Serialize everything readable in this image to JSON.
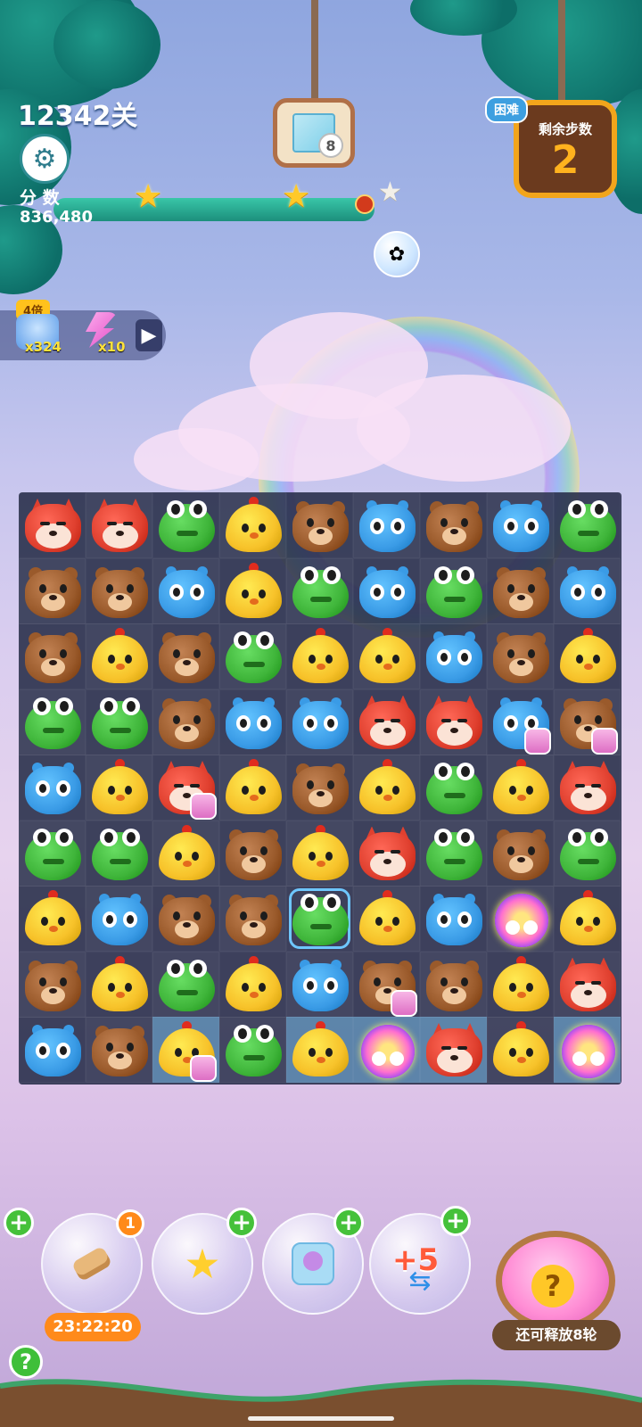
{
  "hud": {
    "level_label": "12342关",
    "score_label": "分 数",
    "score_value": "836,480",
    "settings_icon": "gear-icon"
  },
  "goal": {
    "count": "8",
    "item": "ice-tile"
  },
  "moves": {
    "difficulty": "困难",
    "label": "剩余步数",
    "value": "2"
  },
  "progress": {
    "stars_earned": 2,
    "stars_total": 3
  },
  "boosters_strip": {
    "multiplier": "4倍",
    "items": [
      {
        "icon": "blue-cloud-booster-icon",
        "count": "x324"
      },
      {
        "icon": "lightning-booster-icon",
        "count": "x10"
      }
    ],
    "expand_icon": "play-triangle-icon"
  },
  "board": {
    "cols": 9,
    "rows": 9,
    "pieces": [
      [
        "fox",
        "fox",
        "frog",
        "chick",
        "bear",
        "hippo",
        "bear",
        "hippo",
        "frog"
      ],
      [
        "bear",
        "bear",
        "hippo",
        "chick",
        "frog",
        "hippo",
        "frog",
        "bear",
        "hippo"
      ],
      [
        "bear",
        "chick",
        "bear",
        "frog",
        "chick",
        "chick",
        "hippo",
        "bear",
        "chick"
      ],
      [
        "frog",
        "frog",
        "bear",
        "hippo",
        "hippo",
        "fox",
        "fox",
        "hippo",
        "bear"
      ],
      [
        "hippo",
        "chick",
        "fox",
        "chick",
        "bear",
        "chick",
        "frog",
        "chick",
        "fox"
      ],
      [
        "frog",
        "frog",
        "chick",
        "bear",
        "chick",
        "fox",
        "frog",
        "bear",
        "frog"
      ],
      [
        "chick",
        "hippo",
        "bear",
        "bear",
        "frog",
        "chick",
        "hippo",
        "owl",
        "chick"
      ],
      [
        "bear",
        "chick",
        "frog",
        "chick",
        "hippo",
        "bear",
        "bear",
        "chick",
        "fox"
      ],
      [
        "hippo",
        "bear",
        "chick",
        "frog",
        "chick",
        "owl",
        "fox",
        "chick",
        "owl"
      ]
    ],
    "jars": [
      [
        3,
        7
      ],
      [
        3,
        8
      ],
      [
        4,
        2
      ],
      [
        7,
        5
      ],
      [
        8,
        2
      ]
    ],
    "ice_cells": [
      [
        8,
        2
      ],
      [
        8,
        4
      ],
      [
        8,
        5
      ],
      [
        8,
        6
      ],
      [
        8,
        8
      ]
    ],
    "selected": [
      6,
      4
    ]
  },
  "tools": [
    {
      "name": "hammer",
      "icon": "hammer-icon",
      "badge": "1",
      "timer": "23:22:20"
    },
    {
      "name": "magic-wand",
      "icon": "star-wand-icon"
    },
    {
      "name": "octopus",
      "icon": "octopus-icon"
    },
    {
      "name": "extra-moves",
      "icon": "swap-arrows-icon",
      "label": "+5"
    }
  ],
  "lucky_bag": {
    "icon": "lucky-bag-icon",
    "text": "还可释放8轮"
  },
  "help": {
    "label": "?"
  },
  "colors": {
    "fox": "#e0402f",
    "frog": "#3fb53a",
    "chick": "#f7c22a",
    "bear": "#9a5a2b",
    "hippo": "#3a9be6"
  }
}
